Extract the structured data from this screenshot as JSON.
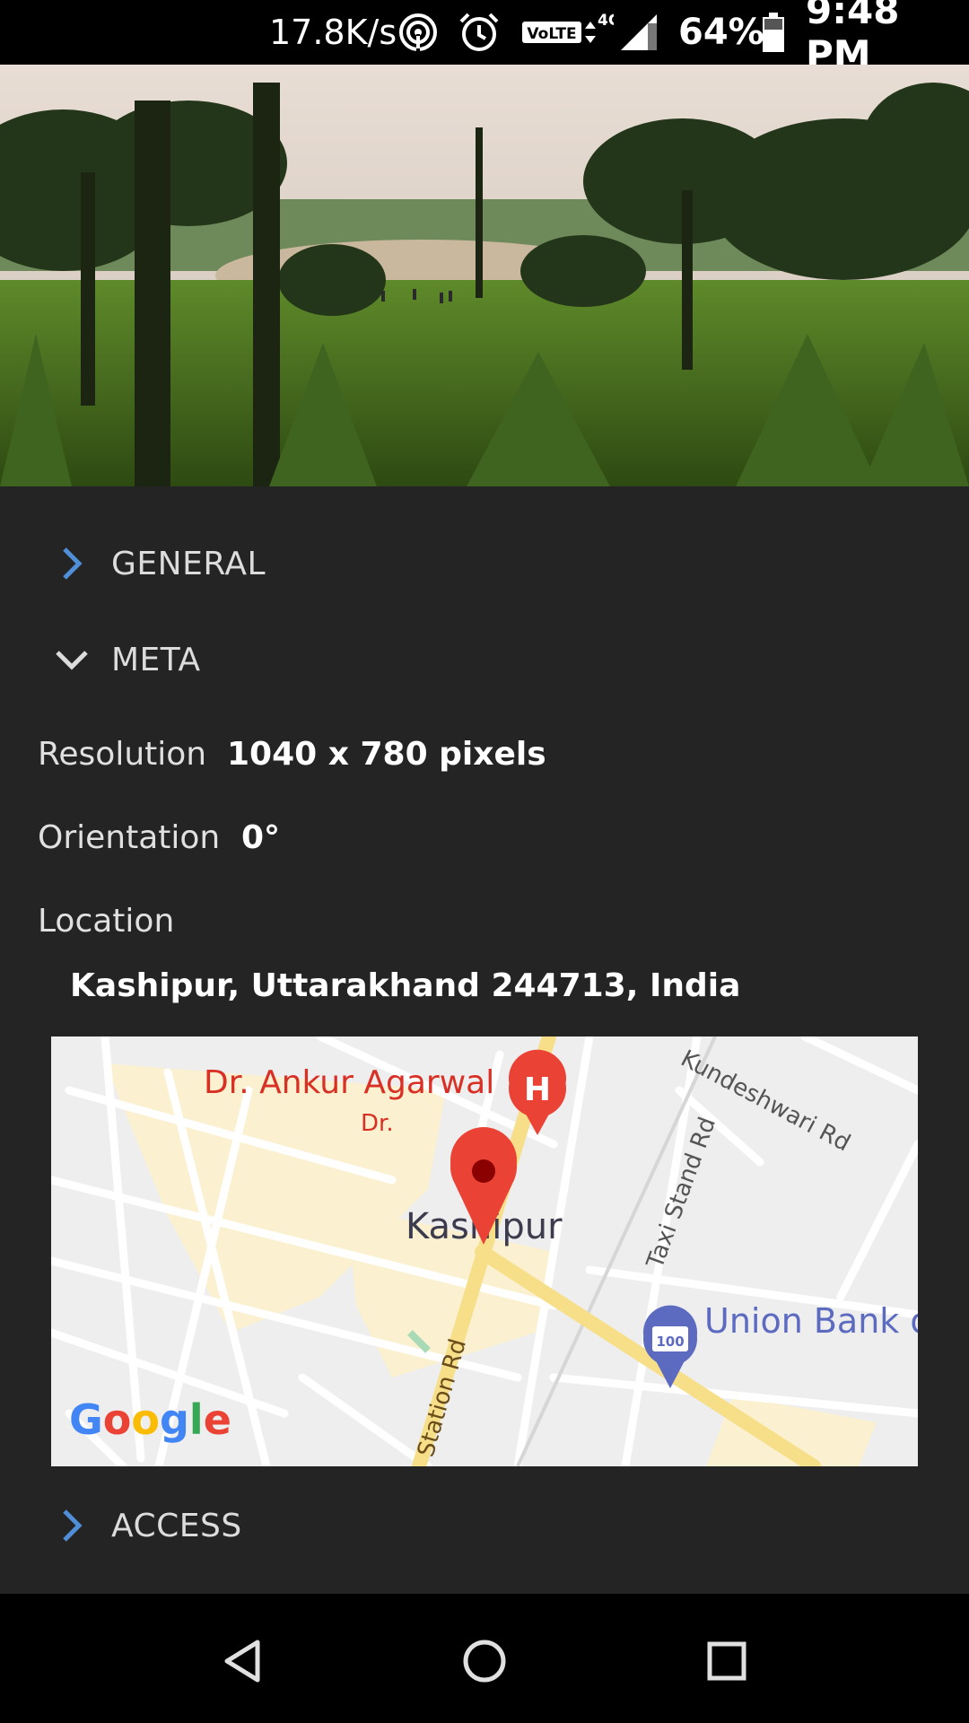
{
  "status_bar": {
    "speed": "17.8K/s",
    "network_badge": "VoLTE",
    "network_type": "4G",
    "battery_percent": "64%",
    "time": "9:48 PM",
    "icons": [
      "hotspot-icon",
      "alarm-icon",
      "volte-icon",
      "signal-icon",
      "battery-icon"
    ]
  },
  "sections": {
    "general": {
      "label": "GENERAL",
      "expanded": false
    },
    "meta": {
      "label": "META",
      "expanded": true
    },
    "access": {
      "label": "ACCESS",
      "expanded": false
    }
  },
  "meta": {
    "resolution_label": "Resolution",
    "resolution_value": "1040 x 780 pixels",
    "orientation_label": "Orientation",
    "orientation_value": "0°",
    "location_label": "Location",
    "location_value": "Kashipur, Uttarakhand 244713, India"
  },
  "map": {
    "place_label": "Kashipur",
    "poi_hospital": "Dr. Ankur Agarwal",
    "poi_hospital_line2": "Dr.",
    "poi_bank": "Union Bank o",
    "road_kundeshwari": "Kundeshwari Rd",
    "road_taxi": "Taxi Stand Rd",
    "road_station": "Station Rd",
    "hospital_glyph": "H",
    "bank_glyph": "100",
    "brand": "Google",
    "colors": {
      "pin": "#ea4335",
      "poi_text": "#d93025",
      "bank": "#5c6bc0"
    }
  },
  "nav": {
    "icons": [
      "back-icon",
      "home-icon",
      "recents-icon"
    ]
  },
  "colors": {
    "accent_chevron": "#4f8fd8",
    "background": "#242424"
  }
}
